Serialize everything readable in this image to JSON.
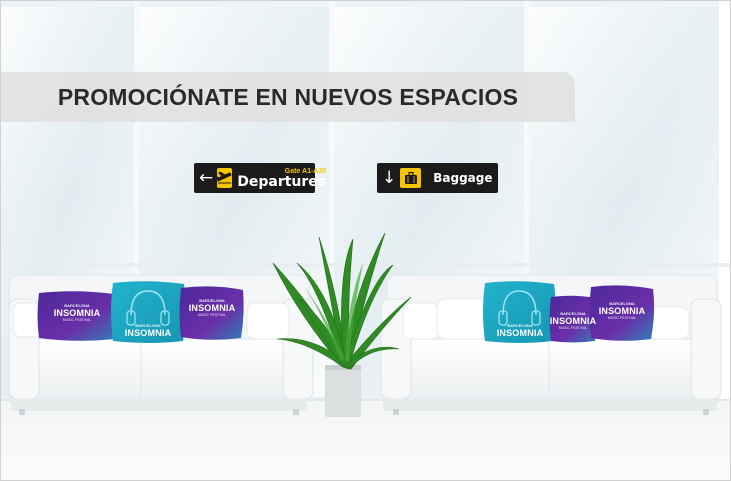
{
  "banner": {
    "title": "PROMOCIÓNATE EN NUEVOS ESPACIOS"
  },
  "signs": {
    "departures": {
      "arrow": "←",
      "gate": "Gate A1-A30",
      "label": "Departures"
    },
    "baggage": {
      "arrow": "↓",
      "label": "Baggage"
    }
  },
  "pillows": {
    "brand_top": "BARCELONA",
    "brand": "INSOMNIA",
    "brand_sub": "MUSIC FESTIVAL"
  },
  "colors": {
    "banner_bg": "#e1e1e1",
    "sign_bg": "#1b1b1b",
    "sign_icon": "#f5c400",
    "pillow_purple": "#5a2d9a",
    "pillow_teal": "#1fa9c4"
  }
}
